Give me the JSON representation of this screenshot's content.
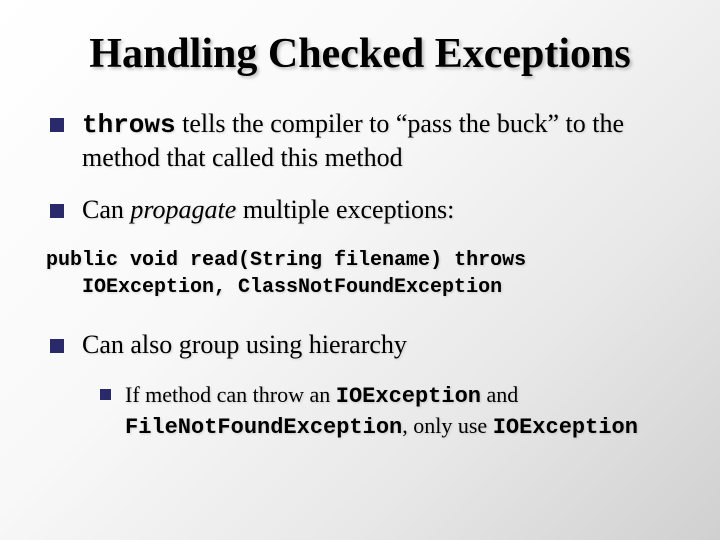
{
  "title": "Handling Checked Exceptions",
  "b1": {
    "code": "throws",
    "rest": " tells the compiler to “pass the buck” to the method that called this method"
  },
  "b2": {
    "pre": "Can ",
    "em": "propagate",
    "post": " multiple exceptions:"
  },
  "code_block": "public void read(String filename) throws IOException, ClassNotFoundException",
  "b3": "Can also group using hierarchy",
  "sub": {
    "pre": "If method can throw an ",
    "c1": "IOException",
    "mid": " and ",
    "c2": "FileNotFoundException",
    "mid2": ", only use ",
    "c3": "IOException"
  }
}
